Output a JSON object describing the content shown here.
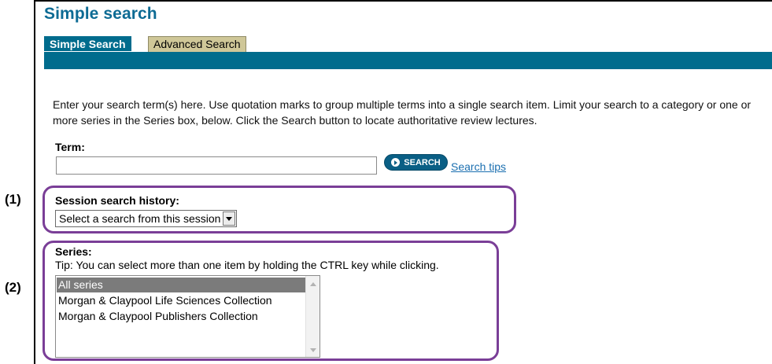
{
  "page": {
    "title": "Simple search"
  },
  "tabs": [
    {
      "label": "Simple Search",
      "active": true
    },
    {
      "label": "Advanced Search",
      "active": false
    }
  ],
  "instructions": "Enter your search term(s) here. Use quotation marks to group multiple terms into a single search item. Limit your search to a category or one or more series in the Series box, below. Click the Search button to locate authoritative review lectures.",
  "term": {
    "label": "Term:",
    "value": "",
    "search_button_label": "SEARCH",
    "search_tips_link": "Search tips"
  },
  "session_history": {
    "label": "Session search history:",
    "selected": "Select a search from this session"
  },
  "series": {
    "label": "Series:",
    "tip": "Tip: You can select more than one item by holding the CTRL key while clicking.",
    "items": [
      {
        "label": "All series",
        "selected": true
      },
      {
        "label": "Morgan & Claypool Life Sciences Collection",
        "selected": false
      },
      {
        "label": "Morgan & Claypool Publishers Collection",
        "selected": false
      }
    ]
  },
  "annotations": {
    "one": "(1)",
    "two": "(2)"
  },
  "colors": {
    "brand": "#006c8d",
    "title": "#0d6b94",
    "inactive_tab": "#cfc798",
    "annotation": "#7a3e97",
    "link": "#1b6fb0"
  }
}
